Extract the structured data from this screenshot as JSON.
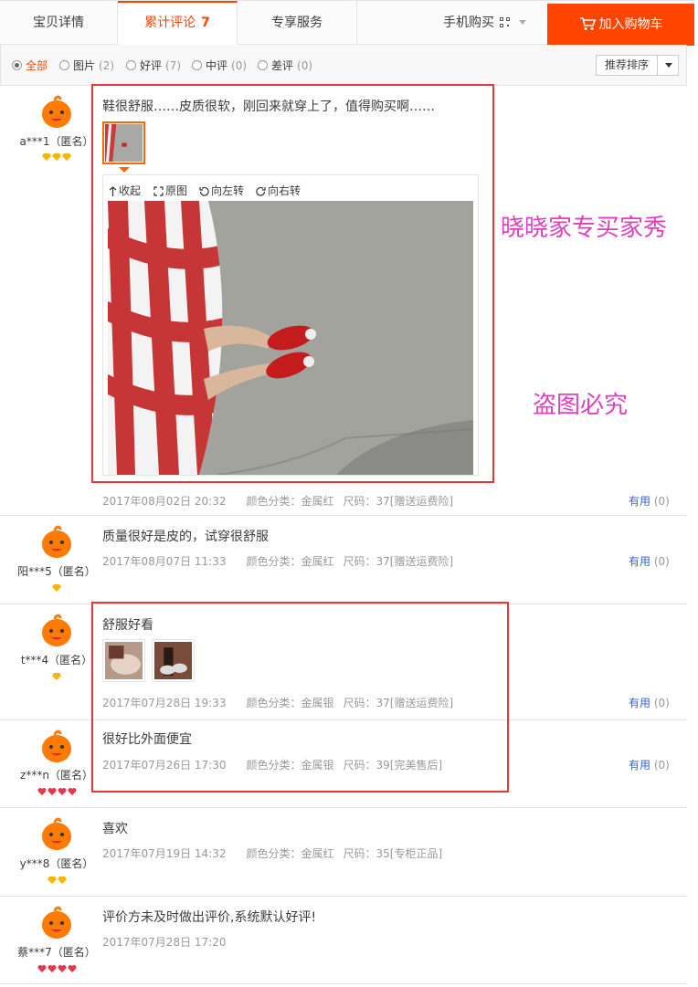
{
  "tabs": [
    {
      "label": "宝贝详情"
    },
    {
      "label": "累计评论",
      "count": "7"
    },
    {
      "label": "专享服务"
    }
  ],
  "mobile_buy": "手机购买",
  "add_to_cart": "加入购物车",
  "filters": [
    {
      "label": "全部",
      "count": ""
    },
    {
      "label": "图片",
      "count": "(2)"
    },
    {
      "label": "好评",
      "count": "(7)"
    },
    {
      "label": "中评",
      "count": "(0)"
    },
    {
      "label": "差评",
      "count": "(0)"
    }
  ],
  "sort_label": "推荐排序",
  "viewer_tools": [
    "收起",
    "原图",
    "向左转",
    "向右转"
  ],
  "overlay_text": [
    "晓晓家专买家秀",
    "盗图必究"
  ],
  "colors": {
    "accent": "#ff4400",
    "overlay_box": "#e53935",
    "overlay_text": "#e040c0",
    "useful_link": "#3366cc"
  },
  "reviews": [
    {
      "user": "a***1（匿名）",
      "level": "3 yellow diamonds",
      "text": "鞋很舒服……皮质很软，刚回来就穿上了，值得购买啊……",
      "date": "2017年08月02日 20:32",
      "color": "颜色分类：金属红",
      "size": "尺码：37[赠送运费险]",
      "useful": "有用",
      "useful_count": "(0)"
    },
    {
      "user": "阳***5（匿名）",
      "level": "1 yellow diamond",
      "text": "质量很好是皮的，试穿很舒服",
      "date": "2017年08月07日 11:33",
      "color": "颜色分类：金属红",
      "size": "尺码：37[赠送运费险]",
      "useful": "有用",
      "useful_count": "(0)"
    },
    {
      "user": "t***4（匿名）",
      "level": "1 yellow diamond",
      "text": "舒服好看",
      "date": "2017年07月28日 19:33",
      "color": "颜色分类：金属银",
      "size": "尺码：37[赠送运费险]",
      "useful": "有用",
      "useful_count": "(0)"
    },
    {
      "user": "z***n（匿名）",
      "level": "4 red hearts",
      "text": "很好比外面便宜",
      "date": "2017年07月26日 17:30",
      "color": "颜色分类：金属银",
      "size": "尺码：39[完美售后]",
      "useful": "有用",
      "useful_count": "(0)"
    },
    {
      "user": "y***8（匿名）",
      "level": "2 yellow diamonds",
      "text": "喜欢",
      "date": "2017年07月19日 14:32",
      "color": "颜色分类：金属红",
      "size": "尺码：35[专柜正品]",
      "useful": "",
      "useful_count": ""
    },
    {
      "user": "蔡***7（匿名）",
      "level": "4 red hearts",
      "text": "评价方未及时做出评价,系统默认好评!",
      "date": "2017年07月28日 17:20",
      "color": "",
      "size": "",
      "useful": "",
      "useful_count": ""
    }
  ]
}
